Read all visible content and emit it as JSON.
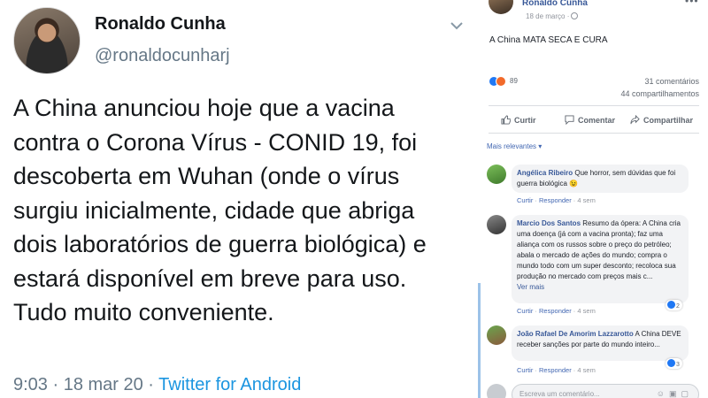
{
  "tweet": {
    "name": "Ronaldo Cunha",
    "handle": "@ronaldocunharj",
    "text": "A China anunciou hoje que a vacina contra o Corona Vírus - CONID 19, foi descoberta em Wuhan (onde o vírus surgiu inicialmente, cidade que abriga dois laboratórios de guerra biológica) e estará disponível em breve para uso. Tudo muito conveniente.",
    "time_date": "9:03 · 18 mar 20 · ",
    "source": "Twitter for Android"
  },
  "facebook": {
    "author": "Ronaldo Cunha",
    "date": "18 de março ·",
    "post_text": "A China MATA SECA E CURA",
    "reaction_count": "89",
    "comments_count": "31 comentários",
    "shares_count": "44 compartilhamentos",
    "actions": {
      "like": "Curtir",
      "comment": "Comentar",
      "share": "Compartilhar"
    },
    "sort_label": "Mais relevantes ▾",
    "comments": [
      {
        "name": "Angélica Ribeiro",
        "text": " Que horror, sem dúvidas que foi guerra biológica 😉",
        "like": "Curtir",
        "reply": "Responder",
        "age": "4 sem"
      },
      {
        "name": "Marcio Dos Santos",
        "text": " Resumo da ópera: A China cria uma doença (já com a vacina pronta); faz uma aliança com os russos sobre o preço do petróleo; abala o mercado de ações do mundo; compra o mundo todo com um super desconto; recoloca sua produção no mercado com preços mais c...",
        "see_more": "Ver mais",
        "like": "Curtir",
        "reply": "Responder",
        "age": "4 sem",
        "likes": "2"
      },
      {
        "name": "João Rafael De Amorim Lazzarotto",
        "text": " A China DEVE receber sanções por parte do mundo inteiro...",
        "like": "Curtir",
        "reply": "Responder",
        "age": "4 sem",
        "likes": "3"
      }
    ],
    "comment_placeholder": "Escreva um comentário..."
  },
  "colors": {
    "twitter_link": "#1b95e0",
    "facebook_link": "#385898",
    "facebook_like": "#2078f4"
  },
  "icons": [
    "chevron-down-icon",
    "globe-icon",
    "more-icon",
    "like-icon",
    "comment-icon",
    "share-icon",
    "emoji-icon",
    "gif-icon",
    "sticker-icon"
  ]
}
